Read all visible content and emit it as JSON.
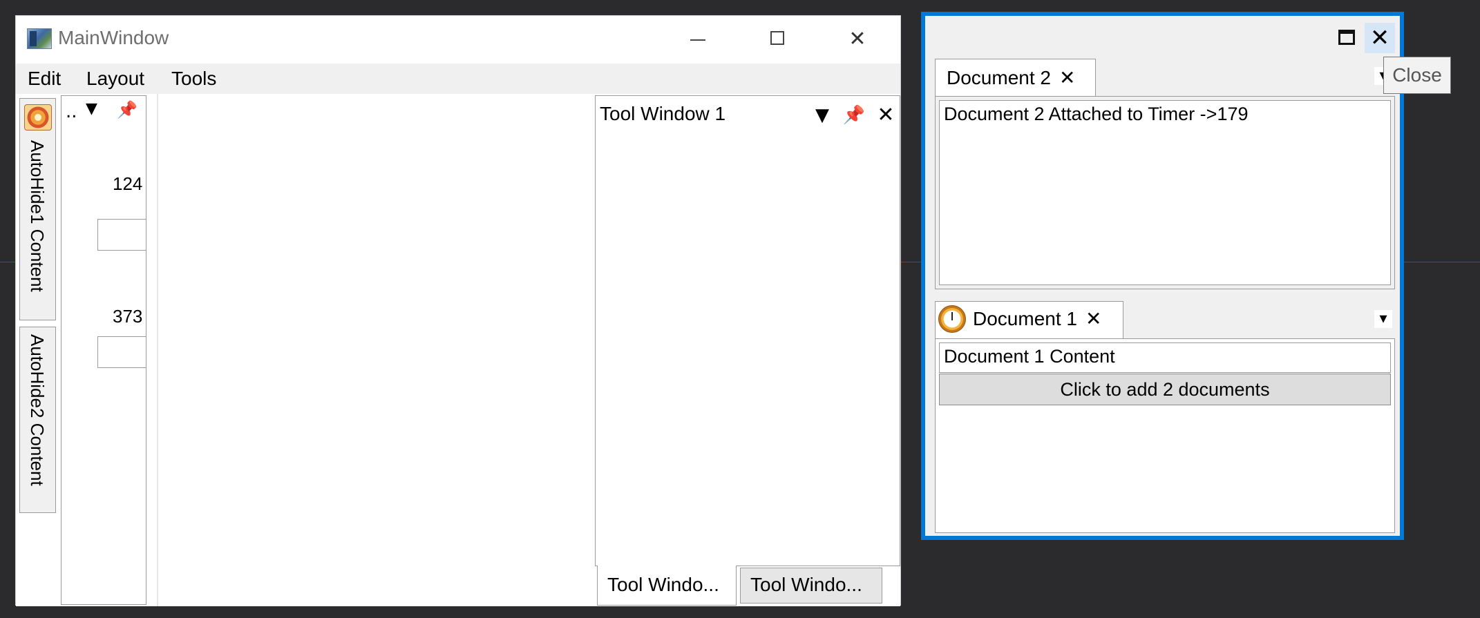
{
  "main_window": {
    "title": "MainWindow",
    "icons": {
      "app": "window-icon",
      "minimize": "minimize-icon",
      "maximize": "maximize-icon",
      "close": "close-icon"
    }
  },
  "menu": {
    "edit": "Edit",
    "layout": "Layout",
    "tools": "Tools"
  },
  "autohide": {
    "tab1_label": "AutoHide1 Content",
    "tab2_label": "AutoHide2 Content",
    "panel_title": "..",
    "value1": "124",
    "value2": "373"
  },
  "tool_window": {
    "title": "Tool Window 1",
    "tabs": [
      "Tool Windo...",
      "Tool Windo..."
    ]
  },
  "float_window": {
    "doc2_tab": "Document 2",
    "doc2_content": "Document 2 Attached to Timer ->179",
    "doc1_tab": "Document 1",
    "doc1_content": "Document 1 Content",
    "doc1_button": "Click to add 2 documents",
    "tooltip": "Close"
  },
  "colors": {
    "accent": "#0078d7",
    "background": "#2b2b2d",
    "panel": "#f0f0f0"
  }
}
